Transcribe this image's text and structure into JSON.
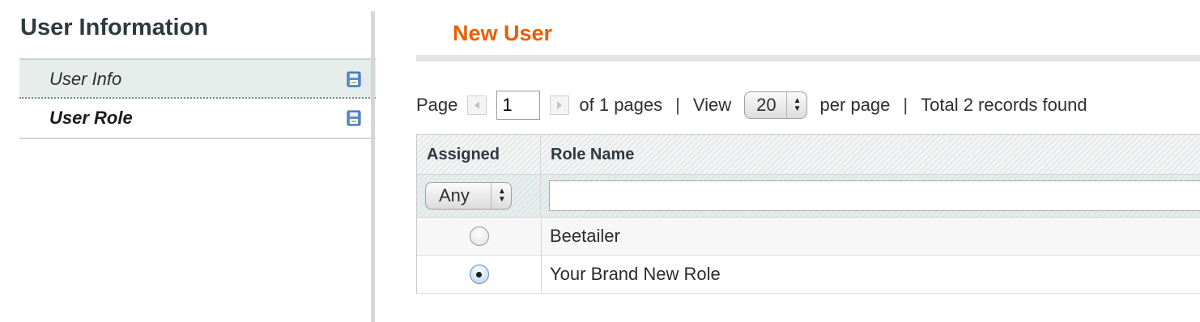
{
  "sidebar": {
    "title": "User Information",
    "tabs": [
      {
        "label": "User Info",
        "icon": "save-icon"
      },
      {
        "label": "User Role",
        "icon": "save-icon"
      }
    ]
  },
  "main": {
    "title": "New User",
    "pager": {
      "page_label": "Page",
      "page_value": "1",
      "of_pages": "of 1 pages",
      "separator": "|",
      "view_label": "View",
      "per_page_value": "20",
      "per_page_label": "per page",
      "total": "Total 2 records found"
    },
    "grid": {
      "columns": [
        "Assigned",
        "Role Name"
      ],
      "filter_assigned": "Any",
      "rows": [
        {
          "assigned": false,
          "role_name": "Beetailer"
        },
        {
          "assigned": true,
          "role_name": "Your Brand New Role"
        }
      ]
    }
  },
  "colors": {
    "accent_title": "#eb5e00",
    "active_tab_bg": "#e6ecea"
  }
}
